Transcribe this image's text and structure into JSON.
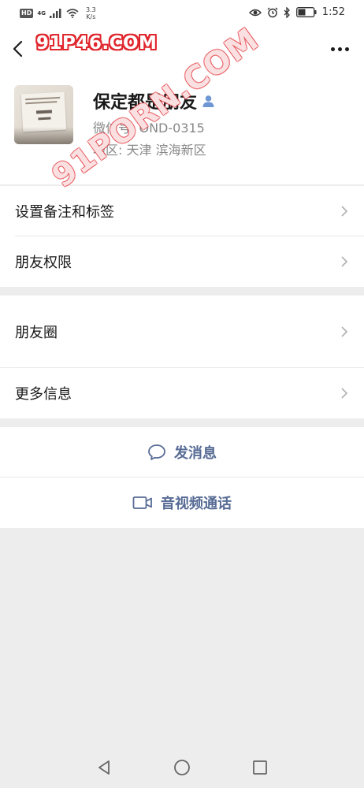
{
  "status_bar": {
    "hd": "HD",
    "network": "4G",
    "speed_value": "3.3",
    "speed_unit": "K/s",
    "time": "1:52",
    "icons": [
      "eye-icon",
      "alarm-icon",
      "bluetooth-icon",
      "battery-icon"
    ]
  },
  "header": {
    "watermark": "91P46.COM"
  },
  "profile": {
    "nickname": "保定都是朋友",
    "wechat_id": "微信号:  OND-0315",
    "region": "地区:  天津  滨海新区",
    "watermark": "91PORN.COM"
  },
  "menu": {
    "set_remark": "设置备注和标签",
    "friend_permissions": "朋友权限",
    "moments": "朋友圈",
    "more_info": "更多信息"
  },
  "actions": {
    "send_message": "发消息",
    "video_call": "音视频通话"
  },
  "colors": {
    "link": "#576b95",
    "background": "#ededed",
    "watermark": "#e0262d"
  }
}
